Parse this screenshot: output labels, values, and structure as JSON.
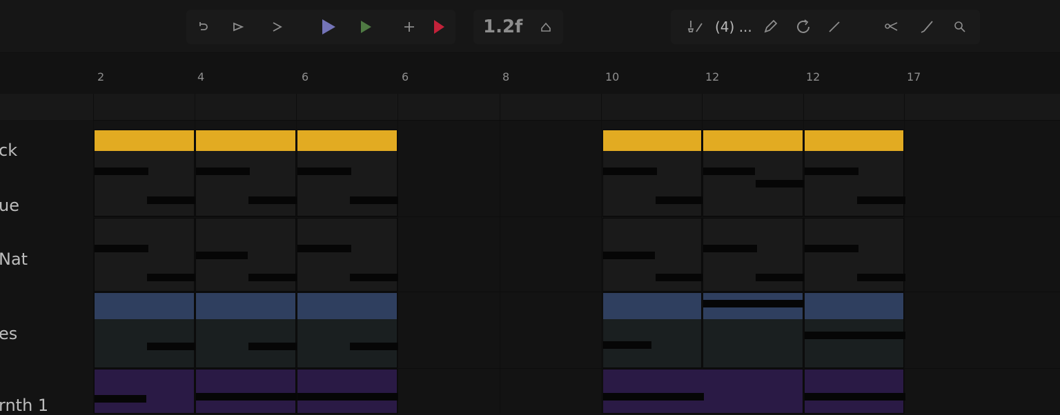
{
  "colors": {
    "background": "#131313",
    "clip_yellow": "#e2ab22",
    "clip_blue": "#2f3f5f",
    "clip_purple": "#2a1a45",
    "clip_body_dark": "#1a1a1a",
    "clip_body_teal": "#1a1f20",
    "play_accent": "#7474b8",
    "play_green": "#4f7a43",
    "record_red": "#c3223a"
  },
  "toolbar": {
    "undo_icon": "undo-icon",
    "step_icon": "step-play-icon",
    "forward_icon": "forward-icon",
    "play_icon": "play-icon",
    "play_pattern_icon": "play-pattern-icon",
    "add_icon": "add-icon",
    "record_icon": "record-icon",
    "tempo": "1.2f",
    "metronome_icon": "metronome-icon",
    "pattern_label": "(4) ...",
    "brush_icon": "brush-icon",
    "pencil_icon": "pencil-icon",
    "loop_icon": "loop-icon",
    "slice_icon": "slice-icon",
    "scissors_icon": "scissors-icon",
    "draw_icon": "draw-line-icon",
    "zoom_icon": "zoom-icon"
  },
  "ruler": {
    "numbers": [
      "2",
      "4",
      "6",
      "6",
      "8",
      "10",
      "12",
      "12",
      "17"
    ]
  },
  "tracks": [
    {
      "name": "ck"
    },
    {
      "name": "ue"
    },
    {
      "name": "Nat"
    },
    {
      "name": "es"
    },
    {
      "name": "rnth 1"
    }
  ]
}
